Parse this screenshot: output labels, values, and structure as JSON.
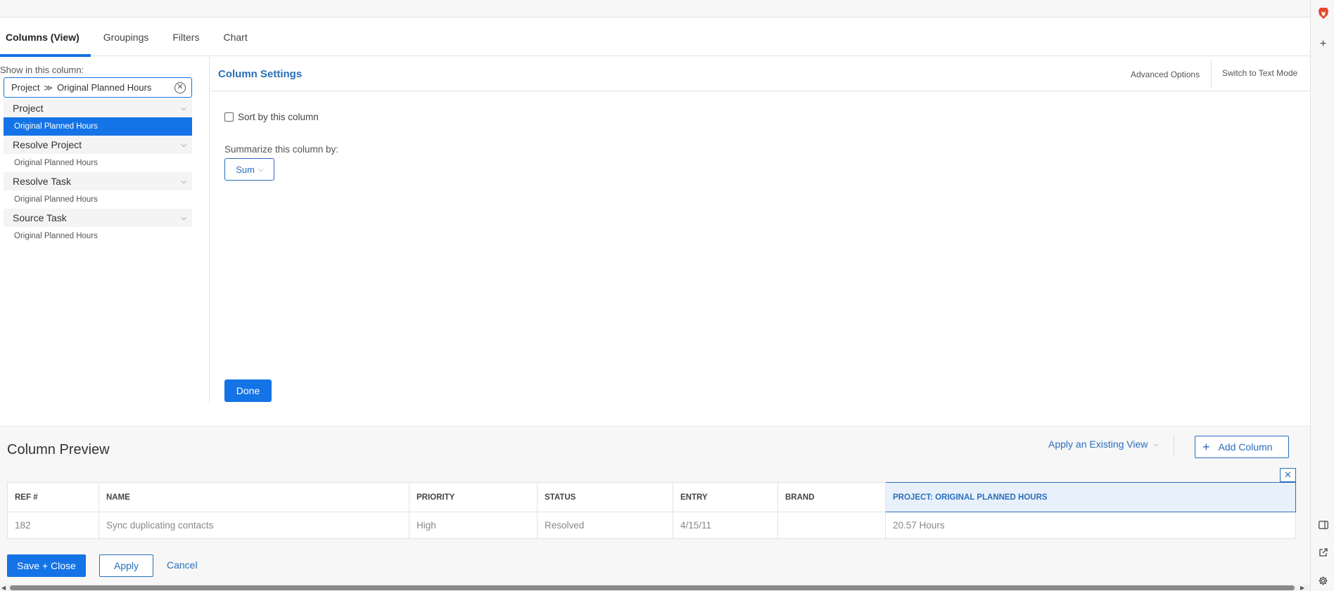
{
  "tabs": [
    {
      "label": "Columns (View)",
      "active": true
    },
    {
      "label": "Groupings",
      "active": false
    },
    {
      "label": "Filters",
      "active": false
    },
    {
      "label": "Chart",
      "active": false
    }
  ],
  "left_panel": {
    "show_label": "Show in this column:",
    "field_path": {
      "part1": "Project",
      "separator": "≫",
      "part2": "Original Planned Hours"
    },
    "groups": [
      {
        "name": "Project",
        "item": "Original Planned Hours",
        "selected": true
      },
      {
        "name": "Resolve Project",
        "item": "Original Planned Hours",
        "selected": false
      },
      {
        "name": "Resolve Task",
        "item": "Original Planned Hours",
        "selected": false
      },
      {
        "name": "Source Task",
        "item": "Original Planned Hours",
        "selected": false
      }
    ]
  },
  "settings": {
    "title": "Column Settings",
    "advanced_options": "Advanced Options",
    "switch_text_mode": "Switch to Text Mode",
    "sort_label": "Sort by this column",
    "sort_checked": false,
    "summarize_label": "Summarize this column by:",
    "summarize_value": "Sum",
    "done_label": "Done"
  },
  "preview": {
    "title": "Column Preview",
    "apply_view": "Apply an Existing View",
    "add_column": "Add Column",
    "close_symbol": "✕",
    "columns": [
      "REF #",
      "NAME",
      "PRIORITY",
      "STATUS",
      "ENTRY",
      "BRAND",
      "PROJECT: ORIGINAL PLANNED HOURS"
    ],
    "rows": [
      [
        "182",
        "Sync duplicating contacts",
        "High",
        "Resolved",
        "4/15/11",
        "",
        "20.57 Hours"
      ]
    ]
  },
  "footer": {
    "save_close": "Save + Close",
    "apply": "Apply",
    "cancel": "Cancel"
  },
  "colors": {
    "accent": "#1473e6",
    "link": "#2a6ebb",
    "highlight_bg": "#e8f1fb"
  },
  "icons": {
    "field_clear": "clear-circle-icon",
    "group_expand": "chevron-down-icon",
    "add": "plus-icon",
    "browser_sidebar": [
      "brave-lion-icon",
      "plus-icon",
      "sidebar-panel-icon",
      "external-link-icon",
      "gear-icon"
    ]
  }
}
